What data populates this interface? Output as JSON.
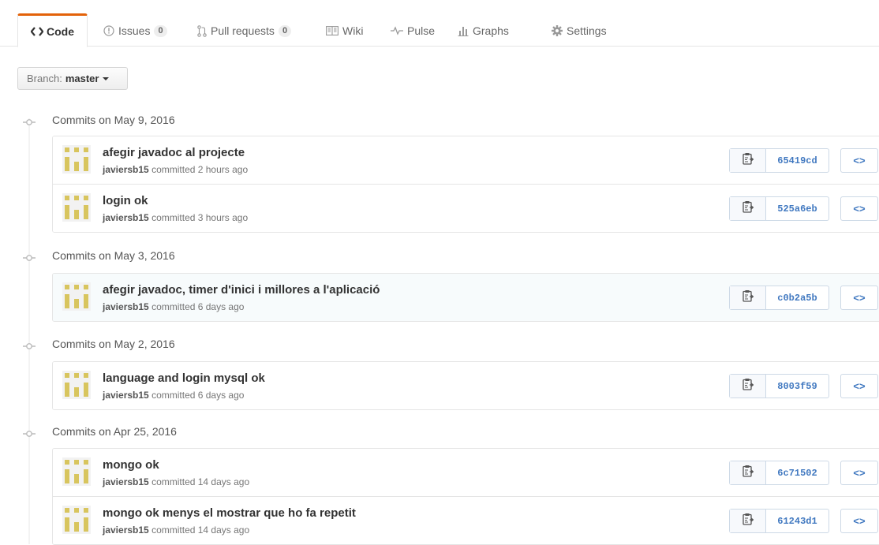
{
  "tabs": [
    {
      "label": "Code",
      "icon": "code-icon",
      "selected": true
    },
    {
      "label": "Issues",
      "icon": "issue-opened-icon",
      "count": "0"
    },
    {
      "label": "Pull requests",
      "icon": "git-pull-request-icon",
      "count": "0"
    },
    {
      "label": "Wiki",
      "icon": "book-icon"
    },
    {
      "label": "Pulse",
      "icon": "pulse-icon"
    },
    {
      "label": "Graphs",
      "icon": "graph-icon"
    },
    {
      "label": "Settings",
      "icon": "gear-icon"
    }
  ],
  "branch": {
    "label": "Branch:",
    "value": "master"
  },
  "groups": [
    {
      "date": "Commits on May 9, 2016",
      "commits": [
        {
          "title": "afegir javadoc al projecte",
          "author": "javiersb15",
          "when": "committed 2 hours ago",
          "sha": "65419cd"
        },
        {
          "title": "login ok",
          "author": "javiersb15",
          "when": "committed 3 hours ago",
          "sha": "525a6eb"
        }
      ]
    },
    {
      "date": "Commits on May 3, 2016",
      "commits": [
        {
          "title": "afegir javadoc, timer d'inici i millores a l'aplicació",
          "author": "javiersb15",
          "when": "committed 6 days ago",
          "sha": "c0b2a5b"
        }
      ]
    },
    {
      "date": "Commits on May 2, 2016",
      "commits": [
        {
          "title": "language and login mysql ok",
          "author": "javiersb15",
          "when": "committed 6 days ago",
          "sha": "8003f59"
        }
      ]
    },
    {
      "date": "Commits on Apr 25, 2016",
      "commits": [
        {
          "title": "mongo ok",
          "author": "javiersb15",
          "when": "committed 14 days ago",
          "sha": "6c71502"
        },
        {
          "title": "mongo ok menys el mostrar que ho fa repetit",
          "author": "javiersb15",
          "when": "committed 14 days ago",
          "sha": "61243d1"
        }
      ]
    }
  ],
  "browse_label": "<>",
  "colors": {
    "accent": "#e36209",
    "link": "#4078c0",
    "avatar": "#d8c55e"
  }
}
